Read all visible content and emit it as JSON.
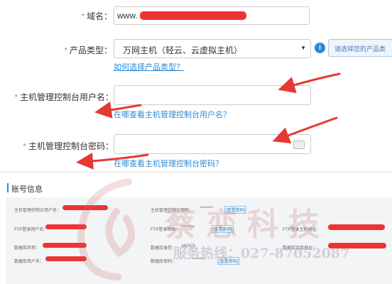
{
  "form": {
    "domain": {
      "star": "*",
      "label": "域名：",
      "value": "www."
    },
    "product": {
      "star": "*",
      "label": "产品类型：",
      "selected": "万网主机（轻云、云虚拟主机）",
      "help_link": "如何选择产品类型？",
      "hint": "请选择您的产品类"
    },
    "username": {
      "star": "*",
      "label": "主机管理控制台用户名：",
      "value": "",
      "help_link": "在哪查看主机管理控制台用户名？"
    },
    "password": {
      "star": "*",
      "label": "主机管理控制台密码：",
      "value": "",
      "help_link": "在哪查看主机管理控制台密码？"
    }
  },
  "account": {
    "title": "账号信息",
    "rows": [
      {
        "l1": "主机管理控制台用户名：",
        "l2": "主机管理控制台密码：",
        "v2": "********",
        "btn2": "[重置密码]"
      },
      {
        "l1": "FTP登录用户名：",
        "l2": "FTP登录密码：",
        "v2": "********",
        "btn2": "[重置密码]",
        "l3": "FTP登录主机地址："
      },
      {
        "l1": "数据库名称：",
        "l2": "数据库类型：",
        "v2": "MySQL",
        "l3": "数据库连接地址："
      },
      {
        "l1": "数据库用户名：",
        "l2": "数据库密码：",
        "v2": "********",
        "btn2": "[重置密码]"
      }
    ]
  },
  "watermark": {
    "name": "蔡恋科技",
    "phone": "服务热线：027-87052087"
  },
  "colors": {
    "accent": "#2a8ad6",
    "redact": "#e33333",
    "arrow": "#e53935"
  }
}
